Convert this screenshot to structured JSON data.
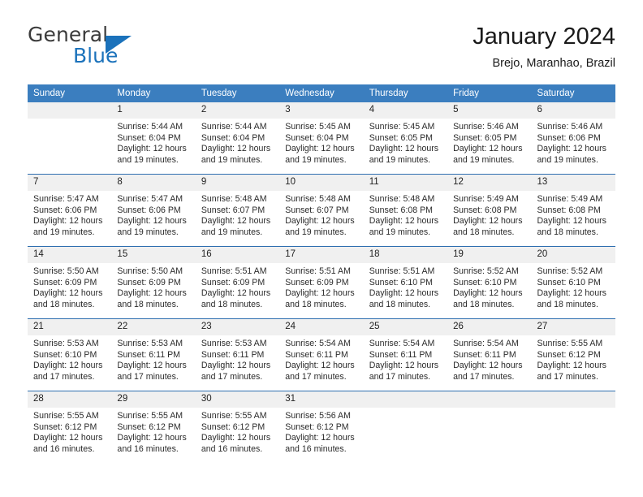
{
  "logo": {
    "word_top": "General",
    "word_bottom": "Blue",
    "triangle_icon": "triangle-icon",
    "color_dark": "#3b3b3b",
    "color_blue": "#1b72bb"
  },
  "header": {
    "title": "January 2024",
    "subtitle": "Brejo, Maranhao, Brazil"
  },
  "theme": {
    "header_bar": "#3b7ebf",
    "row_divider": "#2f6fb0",
    "daynum_band": "#f0f0f0"
  },
  "calendar": {
    "weekday_headers": [
      "Sunday",
      "Monday",
      "Tuesday",
      "Wednesday",
      "Thursday",
      "Friday",
      "Saturday"
    ],
    "weeks": [
      [
        {
          "day": "",
          "sunrise": "",
          "sunset": "",
          "daylight_line1": "",
          "daylight_line2": "",
          "blank": true
        },
        {
          "day": "1",
          "sunrise": "Sunrise: 5:44 AM",
          "sunset": "Sunset: 6:04 PM",
          "daylight_line1": "Daylight: 12 hours",
          "daylight_line2": "and 19 minutes."
        },
        {
          "day": "2",
          "sunrise": "Sunrise: 5:44 AM",
          "sunset": "Sunset: 6:04 PM",
          "daylight_line1": "Daylight: 12 hours",
          "daylight_line2": "and 19 minutes."
        },
        {
          "day": "3",
          "sunrise": "Sunrise: 5:45 AM",
          "sunset": "Sunset: 6:04 PM",
          "daylight_line1": "Daylight: 12 hours",
          "daylight_line2": "and 19 minutes."
        },
        {
          "day": "4",
          "sunrise": "Sunrise: 5:45 AM",
          "sunset": "Sunset: 6:05 PM",
          "daylight_line1": "Daylight: 12 hours",
          "daylight_line2": "and 19 minutes."
        },
        {
          "day": "5",
          "sunrise": "Sunrise: 5:46 AM",
          "sunset": "Sunset: 6:05 PM",
          "daylight_line1": "Daylight: 12 hours",
          "daylight_line2": "and 19 minutes."
        },
        {
          "day": "6",
          "sunrise": "Sunrise: 5:46 AM",
          "sunset": "Sunset: 6:06 PM",
          "daylight_line1": "Daylight: 12 hours",
          "daylight_line2": "and 19 minutes."
        }
      ],
      [
        {
          "day": "7",
          "sunrise": "Sunrise: 5:47 AM",
          "sunset": "Sunset: 6:06 PM",
          "daylight_line1": "Daylight: 12 hours",
          "daylight_line2": "and 19 minutes."
        },
        {
          "day": "8",
          "sunrise": "Sunrise: 5:47 AM",
          "sunset": "Sunset: 6:06 PM",
          "daylight_line1": "Daylight: 12 hours",
          "daylight_line2": "and 19 minutes."
        },
        {
          "day": "9",
          "sunrise": "Sunrise: 5:48 AM",
          "sunset": "Sunset: 6:07 PM",
          "daylight_line1": "Daylight: 12 hours",
          "daylight_line2": "and 19 minutes."
        },
        {
          "day": "10",
          "sunrise": "Sunrise: 5:48 AM",
          "sunset": "Sunset: 6:07 PM",
          "daylight_line1": "Daylight: 12 hours",
          "daylight_line2": "and 19 minutes."
        },
        {
          "day": "11",
          "sunrise": "Sunrise: 5:48 AM",
          "sunset": "Sunset: 6:08 PM",
          "daylight_line1": "Daylight: 12 hours",
          "daylight_line2": "and 19 minutes."
        },
        {
          "day": "12",
          "sunrise": "Sunrise: 5:49 AM",
          "sunset": "Sunset: 6:08 PM",
          "daylight_line1": "Daylight: 12 hours",
          "daylight_line2": "and 18 minutes."
        },
        {
          "day": "13",
          "sunrise": "Sunrise: 5:49 AM",
          "sunset": "Sunset: 6:08 PM",
          "daylight_line1": "Daylight: 12 hours",
          "daylight_line2": "and 18 minutes."
        }
      ],
      [
        {
          "day": "14",
          "sunrise": "Sunrise: 5:50 AM",
          "sunset": "Sunset: 6:09 PM",
          "daylight_line1": "Daylight: 12 hours",
          "daylight_line2": "and 18 minutes."
        },
        {
          "day": "15",
          "sunrise": "Sunrise: 5:50 AM",
          "sunset": "Sunset: 6:09 PM",
          "daylight_line1": "Daylight: 12 hours",
          "daylight_line2": "and 18 minutes."
        },
        {
          "day": "16",
          "sunrise": "Sunrise: 5:51 AM",
          "sunset": "Sunset: 6:09 PM",
          "daylight_line1": "Daylight: 12 hours",
          "daylight_line2": "and 18 minutes."
        },
        {
          "day": "17",
          "sunrise": "Sunrise: 5:51 AM",
          "sunset": "Sunset: 6:09 PM",
          "daylight_line1": "Daylight: 12 hours",
          "daylight_line2": "and 18 minutes."
        },
        {
          "day": "18",
          "sunrise": "Sunrise: 5:51 AM",
          "sunset": "Sunset: 6:10 PM",
          "daylight_line1": "Daylight: 12 hours",
          "daylight_line2": "and 18 minutes."
        },
        {
          "day": "19",
          "sunrise": "Sunrise: 5:52 AM",
          "sunset": "Sunset: 6:10 PM",
          "daylight_line1": "Daylight: 12 hours",
          "daylight_line2": "and 18 minutes."
        },
        {
          "day": "20",
          "sunrise": "Sunrise: 5:52 AM",
          "sunset": "Sunset: 6:10 PM",
          "daylight_line1": "Daylight: 12 hours",
          "daylight_line2": "and 18 minutes."
        }
      ],
      [
        {
          "day": "21",
          "sunrise": "Sunrise: 5:53 AM",
          "sunset": "Sunset: 6:10 PM",
          "daylight_line1": "Daylight: 12 hours",
          "daylight_line2": "and 17 minutes."
        },
        {
          "day": "22",
          "sunrise": "Sunrise: 5:53 AM",
          "sunset": "Sunset: 6:11 PM",
          "daylight_line1": "Daylight: 12 hours",
          "daylight_line2": "and 17 minutes."
        },
        {
          "day": "23",
          "sunrise": "Sunrise: 5:53 AM",
          "sunset": "Sunset: 6:11 PM",
          "daylight_line1": "Daylight: 12 hours",
          "daylight_line2": "and 17 minutes."
        },
        {
          "day": "24",
          "sunrise": "Sunrise: 5:54 AM",
          "sunset": "Sunset: 6:11 PM",
          "daylight_line1": "Daylight: 12 hours",
          "daylight_line2": "and 17 minutes."
        },
        {
          "day": "25",
          "sunrise": "Sunrise: 5:54 AM",
          "sunset": "Sunset: 6:11 PM",
          "daylight_line1": "Daylight: 12 hours",
          "daylight_line2": "and 17 minutes."
        },
        {
          "day": "26",
          "sunrise": "Sunrise: 5:54 AM",
          "sunset": "Sunset: 6:11 PM",
          "daylight_line1": "Daylight: 12 hours",
          "daylight_line2": "and 17 minutes."
        },
        {
          "day": "27",
          "sunrise": "Sunrise: 5:55 AM",
          "sunset": "Sunset: 6:12 PM",
          "daylight_line1": "Daylight: 12 hours",
          "daylight_line2": "and 17 minutes."
        }
      ],
      [
        {
          "day": "28",
          "sunrise": "Sunrise: 5:55 AM",
          "sunset": "Sunset: 6:12 PM",
          "daylight_line1": "Daylight: 12 hours",
          "daylight_line2": "and 16 minutes."
        },
        {
          "day": "29",
          "sunrise": "Sunrise: 5:55 AM",
          "sunset": "Sunset: 6:12 PM",
          "daylight_line1": "Daylight: 12 hours",
          "daylight_line2": "and 16 minutes."
        },
        {
          "day": "30",
          "sunrise": "Sunrise: 5:55 AM",
          "sunset": "Sunset: 6:12 PM",
          "daylight_line1": "Daylight: 12 hours",
          "daylight_line2": "and 16 minutes."
        },
        {
          "day": "31",
          "sunrise": "Sunrise: 5:56 AM",
          "sunset": "Sunset: 6:12 PM",
          "daylight_line1": "Daylight: 12 hours",
          "daylight_line2": "and 16 minutes."
        },
        {
          "day": "",
          "sunrise": "",
          "sunset": "",
          "daylight_line1": "",
          "daylight_line2": "",
          "blank": true
        },
        {
          "day": "",
          "sunrise": "",
          "sunset": "",
          "daylight_line1": "",
          "daylight_line2": "",
          "blank": true
        },
        {
          "day": "",
          "sunrise": "",
          "sunset": "",
          "daylight_line1": "",
          "daylight_line2": "",
          "blank": true
        }
      ]
    ]
  }
}
